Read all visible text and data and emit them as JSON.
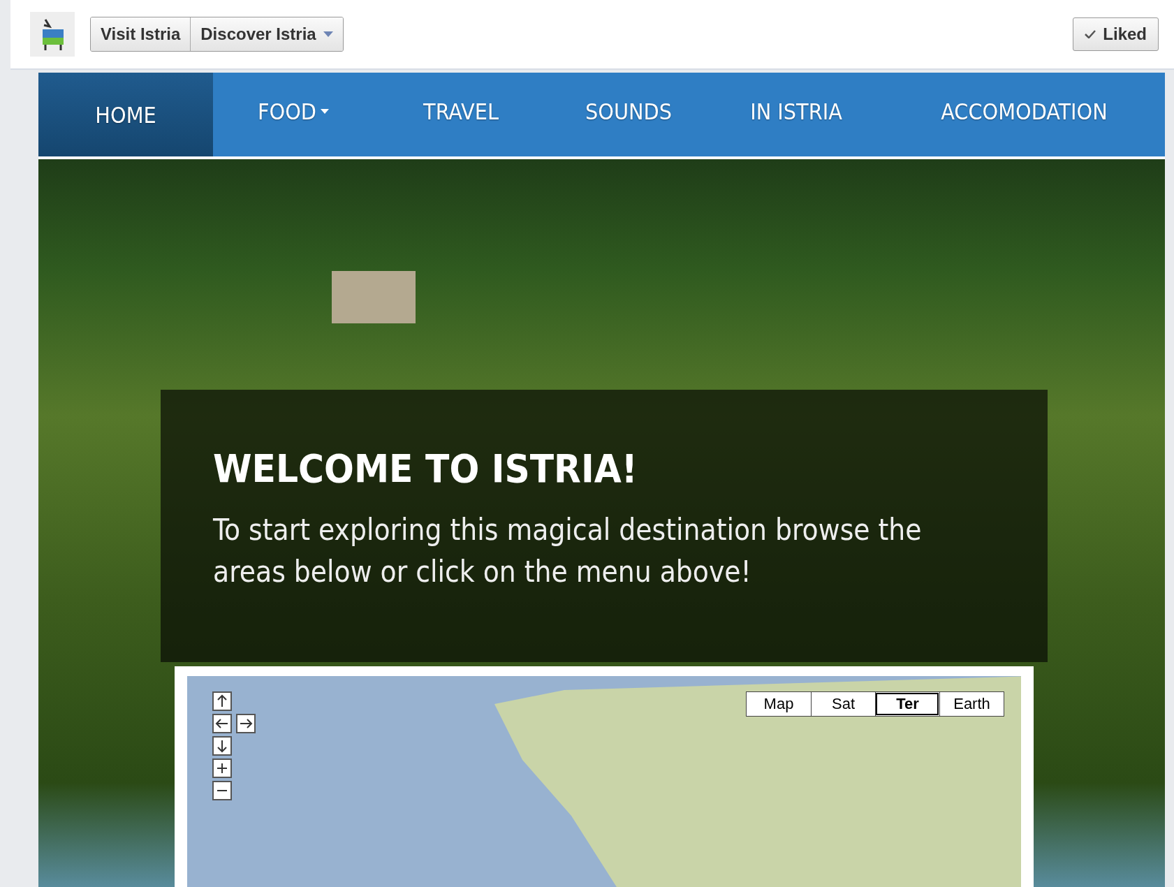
{
  "page_header": {
    "buttons": [
      {
        "label": "Visit Istria",
        "has_menu": false
      },
      {
        "label": "Discover Istria",
        "has_menu": true
      }
    ],
    "like_button": {
      "label": "Liked",
      "checked": true
    }
  },
  "nav": {
    "items": [
      {
        "label": "HOME",
        "selected": true,
        "has_menu": false
      },
      {
        "label": "FOOD",
        "selected": false,
        "has_menu": true
      },
      {
        "label": "TRAVEL",
        "selected": false,
        "has_menu": false
      },
      {
        "label": "SOUNDS",
        "selected": false,
        "has_menu": false
      },
      {
        "label": "IN ISTRIA",
        "selected": false,
        "has_menu": false
      },
      {
        "label": "ACCOMODATION",
        "selected": false,
        "has_menu": false
      }
    ]
  },
  "welcome": {
    "title": "WELCOME TO ISTRIA!",
    "text": "To start exploring this magical destination browse the areas below or click on the menu above!"
  },
  "map": {
    "types": [
      {
        "label": "Map",
        "selected": false
      },
      {
        "label": "Sat",
        "selected": false
      },
      {
        "label": "Ter",
        "selected": true
      },
      {
        "label": "Earth",
        "selected": false
      }
    ]
  }
}
